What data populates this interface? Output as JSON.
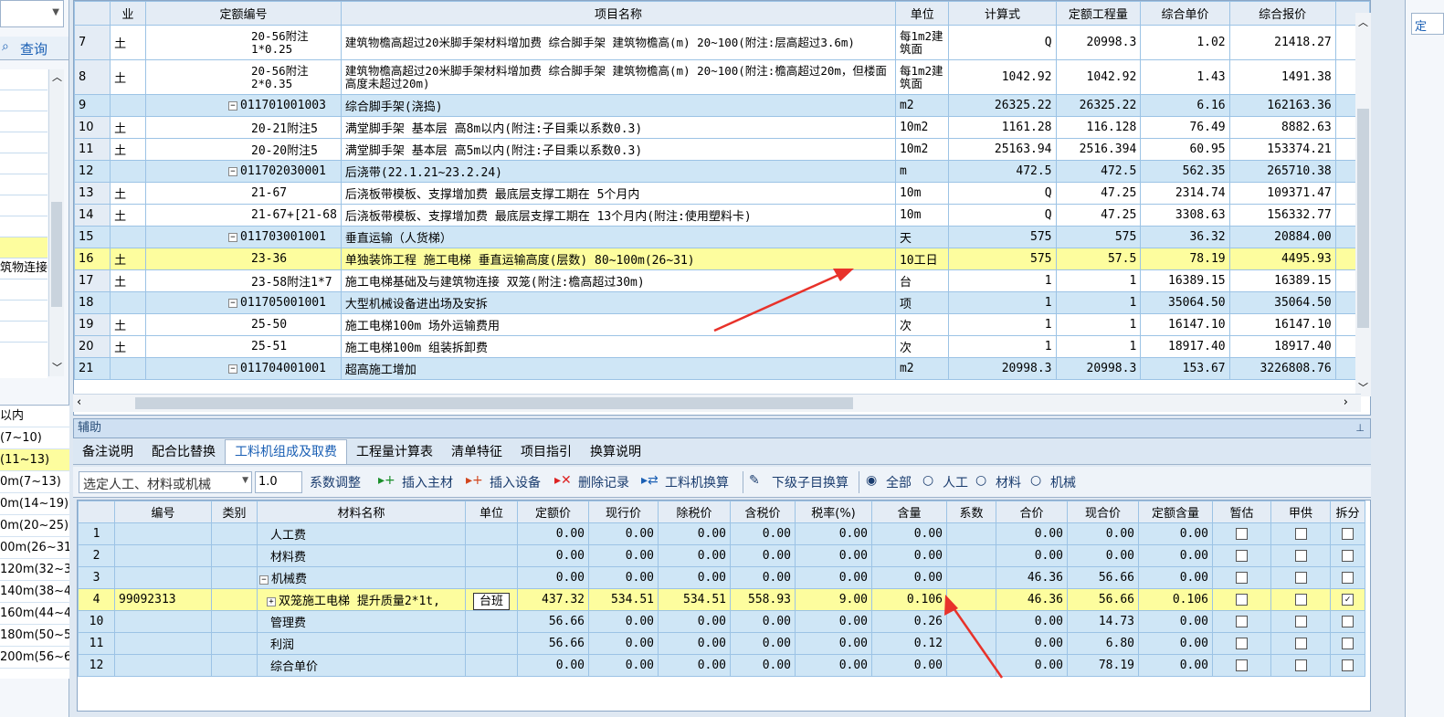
{
  "left_panel": {
    "search_label": "查询",
    "items": [
      "",
      "",
      "",
      "",
      "",
      "",
      "",
      "",
      "",
      "筑物连接",
      "",
      "",
      ""
    ],
    "list2": [
      "以内",
      "(7~10)",
      "(11~13)",
      "0m(7~13)",
      "0m(14~19)",
      "0m(20~25)",
      "00m(26~31",
      "120m(32~3",
      "140m(38~4",
      "160m(44~4",
      "180m(50~5",
      "200m(56~6"
    ]
  },
  "main_grid": {
    "headers": [
      "业",
      "定额编号",
      "项目名称",
      "单位",
      "计算式",
      "定额工程量",
      "综合单价",
      "综合报价"
    ],
    "rows": [
      {
        "n": "7",
        "cat": "土",
        "code": "20-56附注1*0.25",
        "name": "建筑物檐高超过20米脚手架材料增加费 综合脚手架 建筑物檐高(m) 20~100(附注:层高超过3.6m)",
        "unit": "每1m2建筑面",
        "formula": "Q",
        "qty": "20998.3",
        "price": "1.02",
        "total": "21418.27",
        "style": "tall"
      },
      {
        "n": "8",
        "cat": "土",
        "code": "20-56附注2*0.35",
        "name": "建筑物檐高超过20米脚手架材料增加费 综合脚手架 建筑物檐高(m) 20~100(附注:檐高超过20m，但楼面高度未超过20m)",
        "unit": "每1m2建筑面",
        "formula": "1042.92",
        "qty": "1042.92",
        "price": "1.43",
        "total": "1491.38",
        "style": "tall"
      },
      {
        "n": "9",
        "cat": "",
        "code": "011701001003",
        "name": "综合脚手架(浇捣)",
        "unit": "m2",
        "formula": "26325.22",
        "qty": "26325.22",
        "price": "6.16",
        "total": "162163.36",
        "style": "blue"
      },
      {
        "n": "10",
        "cat": "土",
        "code": "20-21附注5",
        "name": "满堂脚手架 基本层 高8m以内(附注:子目乘以系数0.3)",
        "unit": "10m2",
        "formula": "1161.28",
        "qty": "116.128",
        "price": "76.49",
        "total": "8882.63",
        "style": ""
      },
      {
        "n": "11",
        "cat": "土",
        "code": "20-20附注5",
        "name": "满堂脚手架 基本层 高5m以内(附注:子目乘以系数0.3)",
        "unit": "10m2",
        "formula": "25163.94",
        "qty": "2516.394",
        "price": "60.95",
        "total": "153374.21",
        "style": ""
      },
      {
        "n": "12",
        "cat": "",
        "code": "011702030001",
        "name": "后浇带(22.1.21~23.2.24)",
        "unit": "m",
        "formula": "472.5",
        "qty": "472.5",
        "price": "562.35",
        "total": "265710.38",
        "style": "blue"
      },
      {
        "n": "13",
        "cat": "土",
        "code": "21-67",
        "name": "后浇板带模板、支撑增加费 最底层支撑工期在 5个月内",
        "unit": "10m",
        "formula": "Q",
        "qty": "47.25",
        "price": "2314.74",
        "total": "109371.47",
        "style": ""
      },
      {
        "n": "14",
        "cat": "土",
        "code": "21-67+[21-68",
        "name": "后浇板带模板、支撑增加费 最底层支撑工期在 13个月内(附注:使用塑料卡)",
        "unit": "10m",
        "formula": "Q",
        "qty": "47.25",
        "price": "3308.63",
        "total": "156332.77",
        "style": ""
      },
      {
        "n": "15",
        "cat": "",
        "code": "011703001001",
        "name": "垂直运输（人货梯）",
        "unit": "天",
        "formula": "575",
        "qty": "575",
        "price": "36.32",
        "total": "20884.00",
        "style": "blue"
      },
      {
        "n": "16",
        "cat": "土",
        "code": "23-36",
        "name": "单独装饰工程 施工电梯 垂直运输高度(层数) 80~100m(26~31)",
        "unit": "10工日",
        "formula": "575",
        "qty": "57.5",
        "price": "78.19",
        "total": "4495.93",
        "style": "yellow"
      },
      {
        "n": "17",
        "cat": "土",
        "code": "23-58附注1*7",
        "name": "施工电梯基础及与建筑物连接 双笼(附注:檐高超过30m)",
        "unit": "台",
        "formula": "1",
        "qty": "1",
        "price": "16389.15",
        "total": "16389.15",
        "style": ""
      },
      {
        "n": "18",
        "cat": "",
        "code": "011705001001",
        "name": "大型机械设备进出场及安拆",
        "unit": "项",
        "formula": "1",
        "qty": "1",
        "price": "35064.50",
        "total": "35064.50",
        "style": "blue"
      },
      {
        "n": "19",
        "cat": "土",
        "code": "25-50",
        "name": "施工电梯100m 场外运输费用",
        "unit": "次",
        "formula": "1",
        "qty": "1",
        "price": "16147.10",
        "total": "16147.10",
        "style": ""
      },
      {
        "n": "20",
        "cat": "土",
        "code": "25-51",
        "name": "施工电梯100m 组装拆卸费",
        "unit": "次",
        "formula": "1",
        "qty": "1",
        "price": "18917.40",
        "total": "18917.40",
        "style": ""
      },
      {
        "n": "21",
        "cat": "",
        "code": "011704001001",
        "name": "超高施工增加",
        "unit": "m2",
        "formula": "20998.3",
        "qty": "20998.3",
        "price": "153.67",
        "total": "3226808.76",
        "style": "blue"
      }
    ]
  },
  "aux": {
    "title": "辅助",
    "tabs": [
      "备注说明",
      "配合比替换",
      "工料机组成及取费",
      "工程量计算表",
      "清单特征",
      "项目指引",
      "换算说明"
    ],
    "active_tab": 2,
    "toolbar": {
      "select_placeholder": "选定人工、材料或机械",
      "coef_value": "1.0",
      "coef_label": "系数调整",
      "insert_main": "插入主材",
      "insert_equip": "插入设备",
      "delete": "删除记录",
      "swap": "工料机换算",
      "sub_swap": "下级子目换算",
      "filter_all": "全部",
      "filter_labor": "人工",
      "filter_material": "材料",
      "filter_machine": "机械"
    },
    "headers": [
      "编号",
      "类别",
      "材料名称",
      "单位",
      "定额价",
      "现行价",
      "除税价",
      "含税价",
      "税率(%)",
      "含量",
      "系数",
      "合价",
      "现合价",
      "定额含量",
      "暂估",
      "甲供",
      "拆分"
    ],
    "rows": [
      {
        "n": "1",
        "code": "",
        "name": "人工费",
        "unit": "",
        "p1": "0.00",
        "p2": "0.00",
        "p3": "0.00",
        "p4": "0.00",
        "tax": "0.00",
        "content": "0.00",
        "coef": "",
        "sum": "0.00",
        "cur": "0.00",
        "qc": "0.00",
        "chk": false,
        "style": "blue"
      },
      {
        "n": "2",
        "code": "",
        "name": "材料费",
        "unit": "",
        "p1": "0.00",
        "p2": "0.00",
        "p3": "0.00",
        "p4": "0.00",
        "tax": "0.00",
        "content": "0.00",
        "coef": "",
        "sum": "0.00",
        "cur": "0.00",
        "qc": "0.00",
        "chk": false,
        "style": "blue"
      },
      {
        "n": "3",
        "code": "",
        "name": "机械费",
        "unit": "",
        "p1": "0.00",
        "p2": "0.00",
        "p3": "0.00",
        "p4": "0.00",
        "tax": "0.00",
        "content": "0.00",
        "coef": "",
        "sum": "46.36",
        "cur": "56.66",
        "qc": "0.00",
        "chk": false,
        "style": "blue"
      },
      {
        "n": "4",
        "code": "99092313",
        "name": "双笼施工电梯 提升质量2*1t,",
        "unit": "台班",
        "p1": "437.32",
        "p2": "534.51",
        "p3": "534.51",
        "p4": "558.93",
        "tax": "9.00",
        "content": "0.106",
        "coef": "",
        "sum": "46.36",
        "cur": "56.66",
        "qc": "0.106",
        "chk": true,
        "style": "yellow"
      },
      {
        "n": "10",
        "code": "",
        "name": "管理费",
        "unit": "",
        "p1": "56.66",
        "p2": "0.00",
        "p3": "0.00",
        "p4": "0.00",
        "tax": "0.00",
        "content": "0.26",
        "coef": "",
        "sum": "0.00",
        "cur": "14.73",
        "qc": "0.00",
        "chk": false,
        "style": "blue"
      },
      {
        "n": "11",
        "code": "",
        "name": "利润",
        "unit": "",
        "p1": "56.66",
        "p2": "0.00",
        "p3": "0.00",
        "p4": "0.00",
        "tax": "0.00",
        "content": "0.12",
        "coef": "",
        "sum": "0.00",
        "cur": "6.80",
        "qc": "0.00",
        "chk": false,
        "style": "blue"
      },
      {
        "n": "12",
        "code": "",
        "name": "综合单价",
        "unit": "",
        "p1": "0.00",
        "p2": "0.00",
        "p3": "0.00",
        "p4": "0.00",
        "tax": "0.00",
        "content": "0.00",
        "coef": "",
        "sum": "0.00",
        "cur": "78.19",
        "qc": "0.00",
        "chk": false,
        "style": "blue"
      }
    ]
  },
  "right_panel": {
    "label": "定"
  },
  "colors": {
    "highlight_yellow": "#fdfd9e",
    "row_blue": "#cfe6f6",
    "arrow_red": "#e8322a"
  }
}
